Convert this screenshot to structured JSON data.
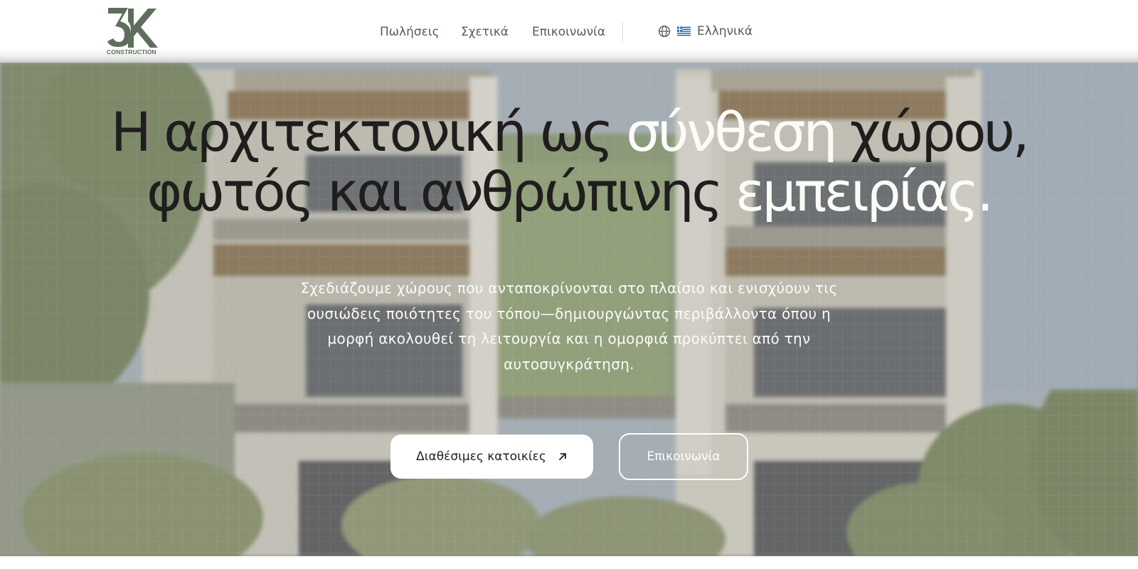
{
  "header": {
    "logo_caption": "CONSTRUCTION",
    "nav": [
      {
        "label": "Πωλήσεις"
      },
      {
        "label": "Σχετικά"
      },
      {
        "label": "Επικοινωνία"
      }
    ],
    "language": {
      "label": "Ελληνικά",
      "icon": "globe-icon",
      "flag": "greek-flag-icon"
    }
  },
  "hero": {
    "headline": {
      "line1_dark": "Η αρχιτεκτονική ως ",
      "line1_light": "σύνθεση",
      "line1_end": " χώρου,",
      "line2_dark": "φωτός και ανθρώπινης ",
      "line2_light": "εμπειρίας."
    },
    "subtitle": "Σχεδιάζουμε χώρους που ανταποκρίνονται στο πλαίσιο και ενισχύουν τις ουσιώδεις ποιότητες του τόπου—δημιουργώντας περιβάλλοντα όπου η μορφή ακολουθεί τη λειτουργία και η ομορφιά προκύπτει από την αυτοσυγκράτηση.",
    "primary_cta": "Διαθέσιμες κατοικίες",
    "secondary_cta": "Επικοινωνία"
  },
  "colors": {
    "brand": "#5e6e5b",
    "headline_dark": "#1f1e1d",
    "headline_light": "#fbfbf8",
    "nav_text": "#555c57"
  }
}
